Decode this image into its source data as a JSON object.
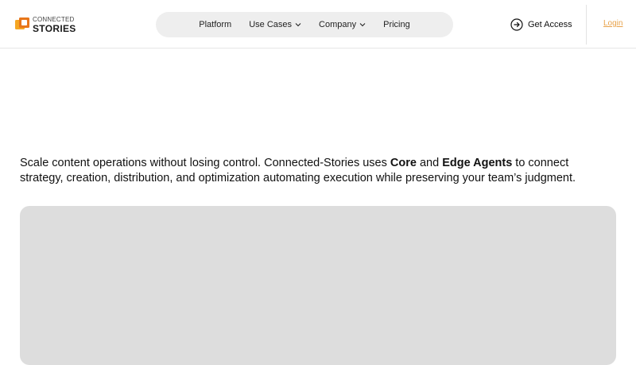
{
  "brand": {
    "line1": "CONNECTED",
    "line2": "STORIES",
    "logo_colors": [
      "#f5a623",
      "#e8761a"
    ]
  },
  "nav": {
    "items": [
      {
        "label": "Platform",
        "dropdown": false
      },
      {
        "label": "Use Cases",
        "dropdown": true
      },
      {
        "label": "Company",
        "dropdown": true
      },
      {
        "label": "Pricing",
        "dropdown": false
      }
    ]
  },
  "header_actions": {
    "get_access_label": "Get Access",
    "get_access_icon": "arrow-right-circle-icon",
    "login_label": "Login",
    "login_color": "#e8a24a"
  },
  "intro": {
    "part1": "Scale content operations without losing control. Connected-Stories uses ",
    "bold1": "Core",
    "part2": " and ",
    "bold2": "Edge Agents",
    "part3": " to connect strategy, creation, distribution, and optimization automating execution while preserving your team’s judgment."
  },
  "colors": {
    "nav_pill_bg": "#eeeeee",
    "media_panel_bg": "#dddddd"
  }
}
